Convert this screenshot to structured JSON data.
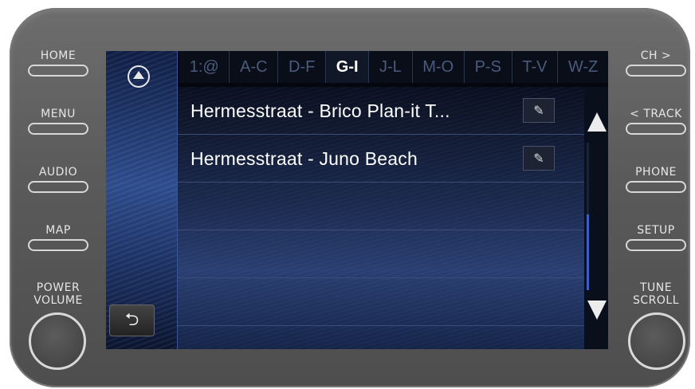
{
  "hardware": {
    "left_buttons": [
      "HOME",
      "MENU",
      "AUDIO",
      "MAP"
    ],
    "right_buttons": [
      "CH >",
      "< TRACK",
      "PHONE",
      "SETUP"
    ],
    "left_knob_label_1": "POWER",
    "left_knob_label_2": "VOLUME",
    "right_knob_label_1": "TUNE",
    "right_knob_label_2": "SCROLL"
  },
  "tabs": [
    {
      "label": "1:@",
      "active": false
    },
    {
      "label": "A-C",
      "active": false
    },
    {
      "label": "D-F",
      "active": false
    },
    {
      "label": "G-I",
      "active": true
    },
    {
      "label": "J-L",
      "active": false
    },
    {
      "label": "M-O",
      "active": false
    },
    {
      "label": "P-S",
      "active": false
    },
    {
      "label": "T-V",
      "active": false
    },
    {
      "label": "W-Z",
      "active": false
    }
  ],
  "list": {
    "items": [
      {
        "label": "Hermesstraat - Brico Plan-it T..."
      },
      {
        "label": "Hermesstraat - Juno Beach"
      }
    ]
  },
  "icons": {
    "nav": "navigation-arrow-icon",
    "back": "back-arrow-icon",
    "edit": "edit-icon",
    "up": "scroll-up-arrow-icon",
    "down": "scroll-down-arrow-icon"
  },
  "colors": {
    "accent": "#3e5ec2",
    "bezel": "#5a5a5a",
    "screen_bg": "#1b2a4f"
  },
  "scroll": {
    "position_fraction": 0.55
  }
}
